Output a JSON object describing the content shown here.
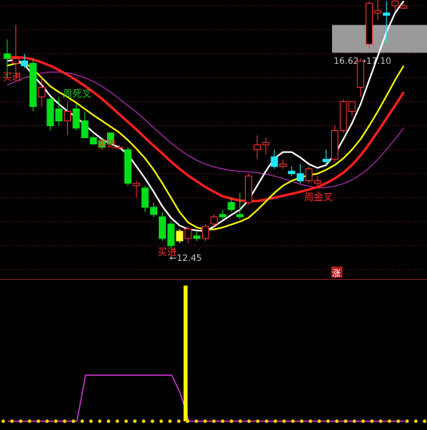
{
  "colors": {
    "background": "#000000",
    "grid": "#8b1a1a",
    "up_candle": "#ff3333",
    "down_candle": "#00e01a",
    "cyan_candle": "#22e6ff",
    "yellow_candle": "#ffff33",
    "ma_white": "#ffffff",
    "ma_yellow": "#ffff00",
    "ma_red": "#ff2020",
    "ma_magenta": "#cc33cc",
    "label_red": "#ff3030",
    "label_green": "#22cc22",
    "low_marker": "#cccccc",
    "price_band": "#999999",
    "zhang_badge": "#b01818",
    "indicator_line": "#cc33cc",
    "indicator_bar": "#ffff00",
    "indicator_dots": "#ffd700"
  },
  "chart_data": [
    {
      "type": "candlestick",
      "series": [
        {
          "name": "candles",
          "values": [
            {
              "o": 16.4,
              "h": 16.8,
              "l": 16.0,
              "c": 16.5,
              "k": "down"
            },
            {
              "o": 16.3,
              "h": 17.1,
              "l": 16.0,
              "c": 16.4,
              "k": "up"
            },
            {
              "o": 16.35,
              "h": 16.5,
              "l": 16.2,
              "c": 16.25,
              "k": "cyan"
            },
            {
              "o": 16.3,
              "h": 16.4,
              "l": 15.3,
              "c": 15.4,
              "k": "down"
            },
            {
              "o": 15.6,
              "h": 16.0,
              "l": 15.4,
              "c": 15.8,
              "k": "up"
            },
            {
              "o": 15.55,
              "h": 15.6,
              "l": 14.9,
              "c": 15.0,
              "k": "down"
            },
            {
              "o": 15.1,
              "h": 15.6,
              "l": 15.0,
              "c": 15.35,
              "k": "down"
            },
            {
              "o": 15.1,
              "h": 15.5,
              "l": 14.8,
              "c": 15.3,
              "k": "up"
            },
            {
              "o": 15.35,
              "h": 15.45,
              "l": 14.9,
              "c": 14.95,
              "k": "down"
            },
            {
              "o": 15.1,
              "h": 15.3,
              "l": 14.9,
              "c": 14.75,
              "k": "down"
            },
            {
              "o": 14.75,
              "h": 14.8,
              "l": 14.6,
              "c": 14.62,
              "k": "down"
            },
            {
              "o": 14.68,
              "h": 14.75,
              "l": 14.5,
              "c": 14.55,
              "k": "down"
            },
            {
              "o": 14.85,
              "h": 14.85,
              "l": 14.6,
              "c": 14.62,
              "k": "down"
            },
            {
              "o": 14.55,
              "h": 14.6,
              "l": 14.5,
              "c": 14.55,
              "k": "up"
            },
            {
              "o": 14.5,
              "h": 14.55,
              "l": 13.75,
              "c": 13.8,
              "k": "down"
            },
            {
              "o": 13.8,
              "h": 13.85,
              "l": 13.5,
              "c": 13.75,
              "k": "up"
            },
            {
              "o": 13.7,
              "h": 13.75,
              "l": 13.2,
              "c": 13.3,
              "k": "down"
            },
            {
              "o": 13.3,
              "h": 13.4,
              "l": 13.1,
              "c": 13.15,
              "k": "down"
            },
            {
              "o": 13.1,
              "h": 13.2,
              "l": 12.6,
              "c": 12.65,
              "k": "down"
            },
            {
              "o": 12.95,
              "h": 13.0,
              "l": 12.45,
              "c": 12.5,
              "k": "down"
            },
            {
              "o": 12.6,
              "h": 12.85,
              "l": 12.55,
              "c": 12.8,
              "k": "yellow"
            },
            {
              "o": 12.65,
              "h": 12.9,
              "l": 12.55,
              "c": 12.85,
              "k": "up"
            },
            {
              "o": 12.7,
              "h": 12.8,
              "l": 12.6,
              "c": 12.65,
              "k": "down"
            },
            {
              "o": 12.65,
              "h": 12.95,
              "l": 12.6,
              "c": 12.9,
              "k": "up"
            },
            {
              "o": 12.95,
              "h": 13.15,
              "l": 12.9,
              "c": 13.1,
              "k": "up"
            },
            {
              "o": 13.1,
              "h": 13.25,
              "l": 13.05,
              "c": 13.15,
              "k": "down"
            },
            {
              "o": 13.25,
              "h": 13.5,
              "l": 13.2,
              "c": 13.4,
              "k": "down"
            },
            {
              "o": 13.1,
              "h": 13.6,
              "l": 13.05,
              "c": 13.15,
              "k": "down"
            },
            {
              "o": 13.4,
              "h": 14.0,
              "l": 13.35,
              "c": 13.95,
              "k": "up"
            },
            {
              "o": 14.5,
              "h": 14.8,
              "l": 14.3,
              "c": 14.6,
              "k": "up"
            },
            {
              "o": 14.6,
              "h": 14.75,
              "l": 14.4,
              "c": 14.65,
              "k": "up"
            },
            {
              "o": 14.35,
              "h": 14.5,
              "l": 14.1,
              "c": 14.15,
              "k": "cyan"
            },
            {
              "o": 14.15,
              "h": 14.3,
              "l": 14.1,
              "c": 14.2,
              "k": "up"
            },
            {
              "o": 14.05,
              "h": 14.15,
              "l": 13.95,
              "c": 14.0,
              "k": "cyan"
            },
            {
              "o": 14.0,
              "h": 14.2,
              "l": 13.8,
              "c": 13.85,
              "k": "cyan"
            },
            {
              "o": 13.85,
              "h": 14.15,
              "l": 13.8,
              "c": 14.1,
              "k": "up"
            },
            {
              "o": 13.8,
              "h": 13.95,
              "l": 13.75,
              "c": 13.85,
              "k": "up"
            },
            {
              "o": 14.3,
              "h": 14.5,
              "l": 14.2,
              "c": 14.25,
              "k": "cyan"
            },
            {
              "o": 14.3,
              "h": 15.0,
              "l": 14.25,
              "c": 14.9,
              "k": "up"
            },
            {
              "o": 14.9,
              "h": 15.55,
              "l": 14.85,
              "c": 15.5,
              "k": "up"
            },
            {
              "o": 15.5,
              "h": 15.5,
              "l": 15.2,
              "c": 15.3,
              "k": "up"
            },
            {
              "o": 15.8,
              "h": 16.4,
              "l": 15.6,
              "c": 16.35,
              "k": "up"
            },
            {
              "o": 16.7,
              "h": 17.6,
              "l": 16.6,
              "c": 17.55,
              "k": "up"
            },
            {
              "o": 17.4,
              "h": 17.75,
              "l": 17.2,
              "c": 17.35,
              "k": "up"
            },
            {
              "o": 17.35,
              "h": 17.6,
              "l": 16.7,
              "c": 17.3,
              "k": "cyan"
            },
            {
              "o": 17.6,
              "h": 17.7,
              "l": 17.4,
              "c": 17.5,
              "k": "up"
            },
            {
              "o": 17.5,
              "h": 17.55,
              "l": 17.45,
              "c": 17.45,
              "k": "up"
            }
          ]
        },
        {
          "name": "ma_white",
          "color_key": "ma_white",
          "values": [
            16.35,
            16.38,
            16.28,
            16.05,
            15.85,
            15.62,
            15.45,
            15.3,
            15.18,
            15.02,
            14.86,
            14.72,
            14.62,
            14.55,
            14.4,
            14.15,
            13.9,
            13.62,
            13.32,
            13.08,
            12.92,
            12.84,
            12.82,
            12.8,
            12.9,
            13.02,
            13.14,
            13.25,
            13.45,
            13.75,
            14.05,
            14.32,
            14.45,
            14.45,
            14.34,
            14.2,
            14.12,
            14.18,
            14.4,
            14.72,
            15.05,
            15.45,
            15.95,
            16.45,
            16.95,
            17.35,
            17.6
          ]
        },
        {
          "name": "ma_yellow",
          "color_key": "ma_yellow",
          "values": [
            16.25,
            16.3,
            16.32,
            16.18,
            16.0,
            15.82,
            15.7,
            15.6,
            15.48,
            15.35,
            15.22,
            15.1,
            14.98,
            14.86,
            14.7,
            14.52,
            14.32,
            14.08,
            13.8,
            13.5,
            13.2,
            12.98,
            12.88,
            12.84,
            12.84,
            12.88,
            12.94,
            13.0,
            13.08,
            13.24,
            13.42,
            13.6,
            13.75,
            13.85,
            13.92,
            13.97,
            14.0,
            14.08,
            14.18,
            14.32,
            14.5,
            14.72,
            15.0,
            15.3,
            15.62,
            15.95,
            16.25
          ]
        },
        {
          "name": "ma_red",
          "color_key": "ma_red",
          "values": [
            16.42,
            16.43,
            16.42,
            16.38,
            16.32,
            16.25,
            16.16,
            16.06,
            15.95,
            15.83,
            15.7,
            15.56,
            15.4,
            15.24,
            15.08,
            14.92,
            14.75,
            14.58,
            14.42,
            14.25,
            14.1,
            13.96,
            13.84,
            13.72,
            13.62,
            13.53,
            13.48,
            13.44,
            13.43,
            13.43,
            13.46,
            13.5,
            13.54,
            13.58,
            13.62,
            13.67,
            13.72,
            13.8,
            13.9,
            14.02,
            14.18,
            14.38,
            14.62,
            14.88,
            15.15,
            15.42,
            15.7
          ]
        },
        {
          "name": "ma_magenta",
          "color_key": "ma_magenta",
          "values": [
            15.85,
            15.92,
            16.0,
            16.05,
            16.1,
            16.12,
            16.12,
            16.1,
            16.06,
            16.0,
            15.92,
            15.82,
            15.7,
            15.56,
            15.42,
            15.28,
            15.12,
            14.96,
            14.8,
            14.64,
            14.5,
            14.38,
            14.28,
            14.2,
            14.14,
            14.1,
            14.07,
            14.05,
            14.04,
            14.02,
            13.99,
            13.95,
            13.9,
            13.84,
            13.78,
            13.74,
            13.7,
            13.71,
            13.74,
            13.79,
            13.87,
            13.98,
            14.12,
            14.3,
            14.5,
            14.72,
            14.95
          ]
        }
      ],
      "price_band": {
        "low": 16.62,
        "high": 17.1,
        "label": "16.62→17.10"
      },
      "low_marker": {
        "index": 19,
        "value": 12.45,
        "label": "←12.45"
      },
      "annotations": [
        {
          "text": "买进",
          "index": 0,
          "value": 15.95,
          "color_key": "label_red",
          "clip": true
        },
        {
          "text": "周死叉",
          "index": 7,
          "value": 15.6,
          "color_key": "label_green"
        },
        {
          "text": "买进",
          "index": 11,
          "value": 14.55,
          "color_key": "label_red"
        },
        {
          "text": "买进",
          "index": 18,
          "value": 12.3,
          "color_key": "label_red"
        },
        {
          "text": "周金叉",
          "index": 35,
          "value": 13.45,
          "color_key": "label_red"
        }
      ],
      "badge": {
        "text": "涨"
      },
      "grid": true,
      "ylim": [
        11.8,
        17.62
      ]
    },
    {
      "type": "line",
      "series": [
        {
          "name": "indicator",
          "color_key": "indicator_line",
          "values": [
            0,
            0,
            0,
            0,
            0,
            0,
            0,
            0,
            0,
            1,
            1,
            1,
            1,
            1,
            1,
            1,
            1,
            1,
            1,
            1,
            0.6,
            0,
            0,
            0,
            0,
            0,
            0,
            0,
            0,
            0,
            0,
            0,
            0,
            0,
            0,
            0,
            0,
            0,
            0,
            0,
            0,
            0,
            0,
            0,
            0,
            0,
            0
          ]
        }
      ],
      "bar_signal": {
        "index": 20,
        "value": 1
      },
      "ylim": [
        0,
        1.0
      ]
    }
  ]
}
